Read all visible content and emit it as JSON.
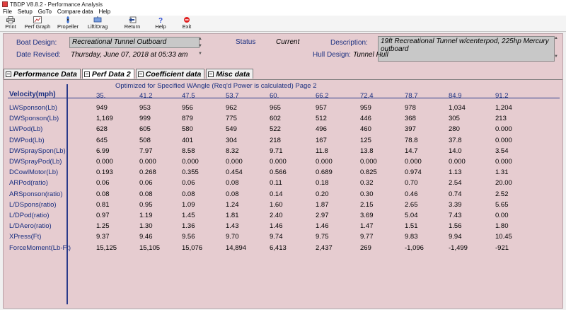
{
  "window": {
    "title": "TBDP V8.8.2 - Performance Analysis"
  },
  "menu": [
    "File",
    "Setup",
    "GoTo",
    "Compare data",
    "Help"
  ],
  "toolbar": [
    {
      "label": "Print",
      "icon": "printer-icon"
    },
    {
      "label": "Perf Graph",
      "icon": "graph-icon"
    },
    {
      "label": "Propeller",
      "icon": "propeller-icon"
    },
    {
      "label": "Lift/Drag",
      "icon": "lift-drag-icon"
    },
    {
      "label": "Return",
      "icon": "return-icon"
    },
    {
      "label": "Help",
      "icon": "help-icon"
    },
    {
      "label": "Exit",
      "icon": "exit-icon"
    }
  ],
  "header": {
    "boat_design_label": "Boat Design:",
    "boat_design_value": "Recreational Tunnel Outboard",
    "status_label": "Status",
    "status_value": "Current",
    "description_label": "Description:",
    "description_value": "19ft Recreational Tunnel w/centerpod, 225hp Mercury outboard",
    "date_revised_label": "Date Revised:",
    "date_revised_value": "Thursday, June 07, 2018 at 05:33 am",
    "hull_design_label": "Hull Design:",
    "hull_design_value": "Tunnel Hull"
  },
  "tabs": [
    {
      "label": "Performance Data",
      "active": false
    },
    {
      "label": "Perf Data 2",
      "active": true
    },
    {
      "label": "Coefficient data",
      "active": false
    },
    {
      "label": "Misc data",
      "active": false
    }
  ],
  "table": {
    "caption": "Optimized for Specified WAngle  (Req'd Power is calculated)     Page 2",
    "velocity_label": "Velocity(mph)",
    "velocities": [
      "35.",
      "41.2",
      "47.5",
      "53.7",
      "60.",
      "66.2",
      "72.4",
      "78.7",
      "84.9",
      "91.2"
    ],
    "rows": [
      {
        "label": "LWSponson(Lb)",
        "values": [
          "949",
          "953",
          "956",
          "962",
          "965",
          "957",
          "959",
          "978",
          "1,034",
          "1,204"
        ]
      },
      {
        "label": "DWSponson(Lb)",
        "values": [
          "1,169",
          "999",
          "879",
          "775",
          "602",
          "512",
          "446",
          "368",
          "305",
          "213"
        ]
      },
      {
        "label": "LWPod(Lb)",
        "values": [
          "628",
          "605",
          "580",
          "549",
          "522",
          "496",
          "460",
          "397",
          "280",
          "0.000"
        ]
      },
      {
        "label": "DWPod(Lb)",
        "values": [
          "645",
          "508",
          "401",
          "304",
          "218",
          "167",
          "125",
          "78.8",
          "37.8",
          "0.000"
        ]
      },
      {
        "label": "DWSpraySpon(Lb)",
        "values": [
          "6.99",
          "7.97",
          "8.58",
          "8.32",
          "9.71",
          "11.8",
          "13.8",
          "14.7",
          "14.0",
          "3.54"
        ]
      },
      {
        "label": "DWSprayPod(Lb)",
        "values": [
          "0.000",
          "0.000",
          "0.000",
          "0.000",
          "0.000",
          "0.000",
          "0.000",
          "0.000",
          "0.000",
          "0.000"
        ]
      },
      {
        "label": "DCowlMotor(Lb)",
        "values": [
          "0.193",
          "0.268",
          "0.355",
          "0.454",
          "0.566",
          "0.689",
          "0.825",
          "0.974",
          "1.13",
          "1.31"
        ]
      },
      {
        "label": "ARPod(ratio)",
        "values": [
          "0.06",
          "0.06",
          "0.06",
          "0.08",
          "0.11",
          "0.18",
          "0.32",
          "0.70",
          "2.54",
          "20.00"
        ]
      },
      {
        "label": "ARSponson(ratio)",
        "values": [
          "0.08",
          "0.08",
          "0.08",
          "0.08",
          "0.14",
          "0.20",
          "0.30",
          "0.46",
          "0.74",
          "2.52"
        ]
      },
      {
        "label": "L/DSpons(ratio)",
        "values": [
          "0.81",
          "0.95",
          "1.09",
          "1.24",
          "1.60",
          "1.87",
          "2.15",
          "2.65",
          "3.39",
          "5.65"
        ]
      },
      {
        "label": "L/DPod(ratio)",
        "values": [
          "0.97",
          "1.19",
          "1.45",
          "1.81",
          "2.40",
          "2.97",
          "3.69",
          "5.04",
          "7.43",
          "0.00"
        ]
      },
      {
        "label": "L/DAero(ratio)",
        "values": [
          "1.25",
          "1.30",
          "1.36",
          "1.43",
          "1.46",
          "1.46",
          "1.47",
          "1.51",
          "1.56",
          "1.80"
        ]
      },
      {
        "label": "XPress(Ft)",
        "values": [
          "9.37",
          "9.46",
          "9.56",
          "9.70",
          "9.74",
          "9.75",
          "9.77",
          "9.83",
          "9.94",
          "10.45"
        ]
      },
      {
        "label": "ForceMoment(Lb-Ft)",
        "values": [
          "15,125",
          "15,105",
          "15,076",
          "14,894",
          "6,413",
          "2,437",
          "269",
          "-1,096",
          "-1,499",
          "-921"
        ]
      }
    ]
  },
  "colors": {
    "panel_bg": "#e6ccd0",
    "label_blue": "#1a2f80",
    "rule_blue": "#2a3a8a"
  }
}
